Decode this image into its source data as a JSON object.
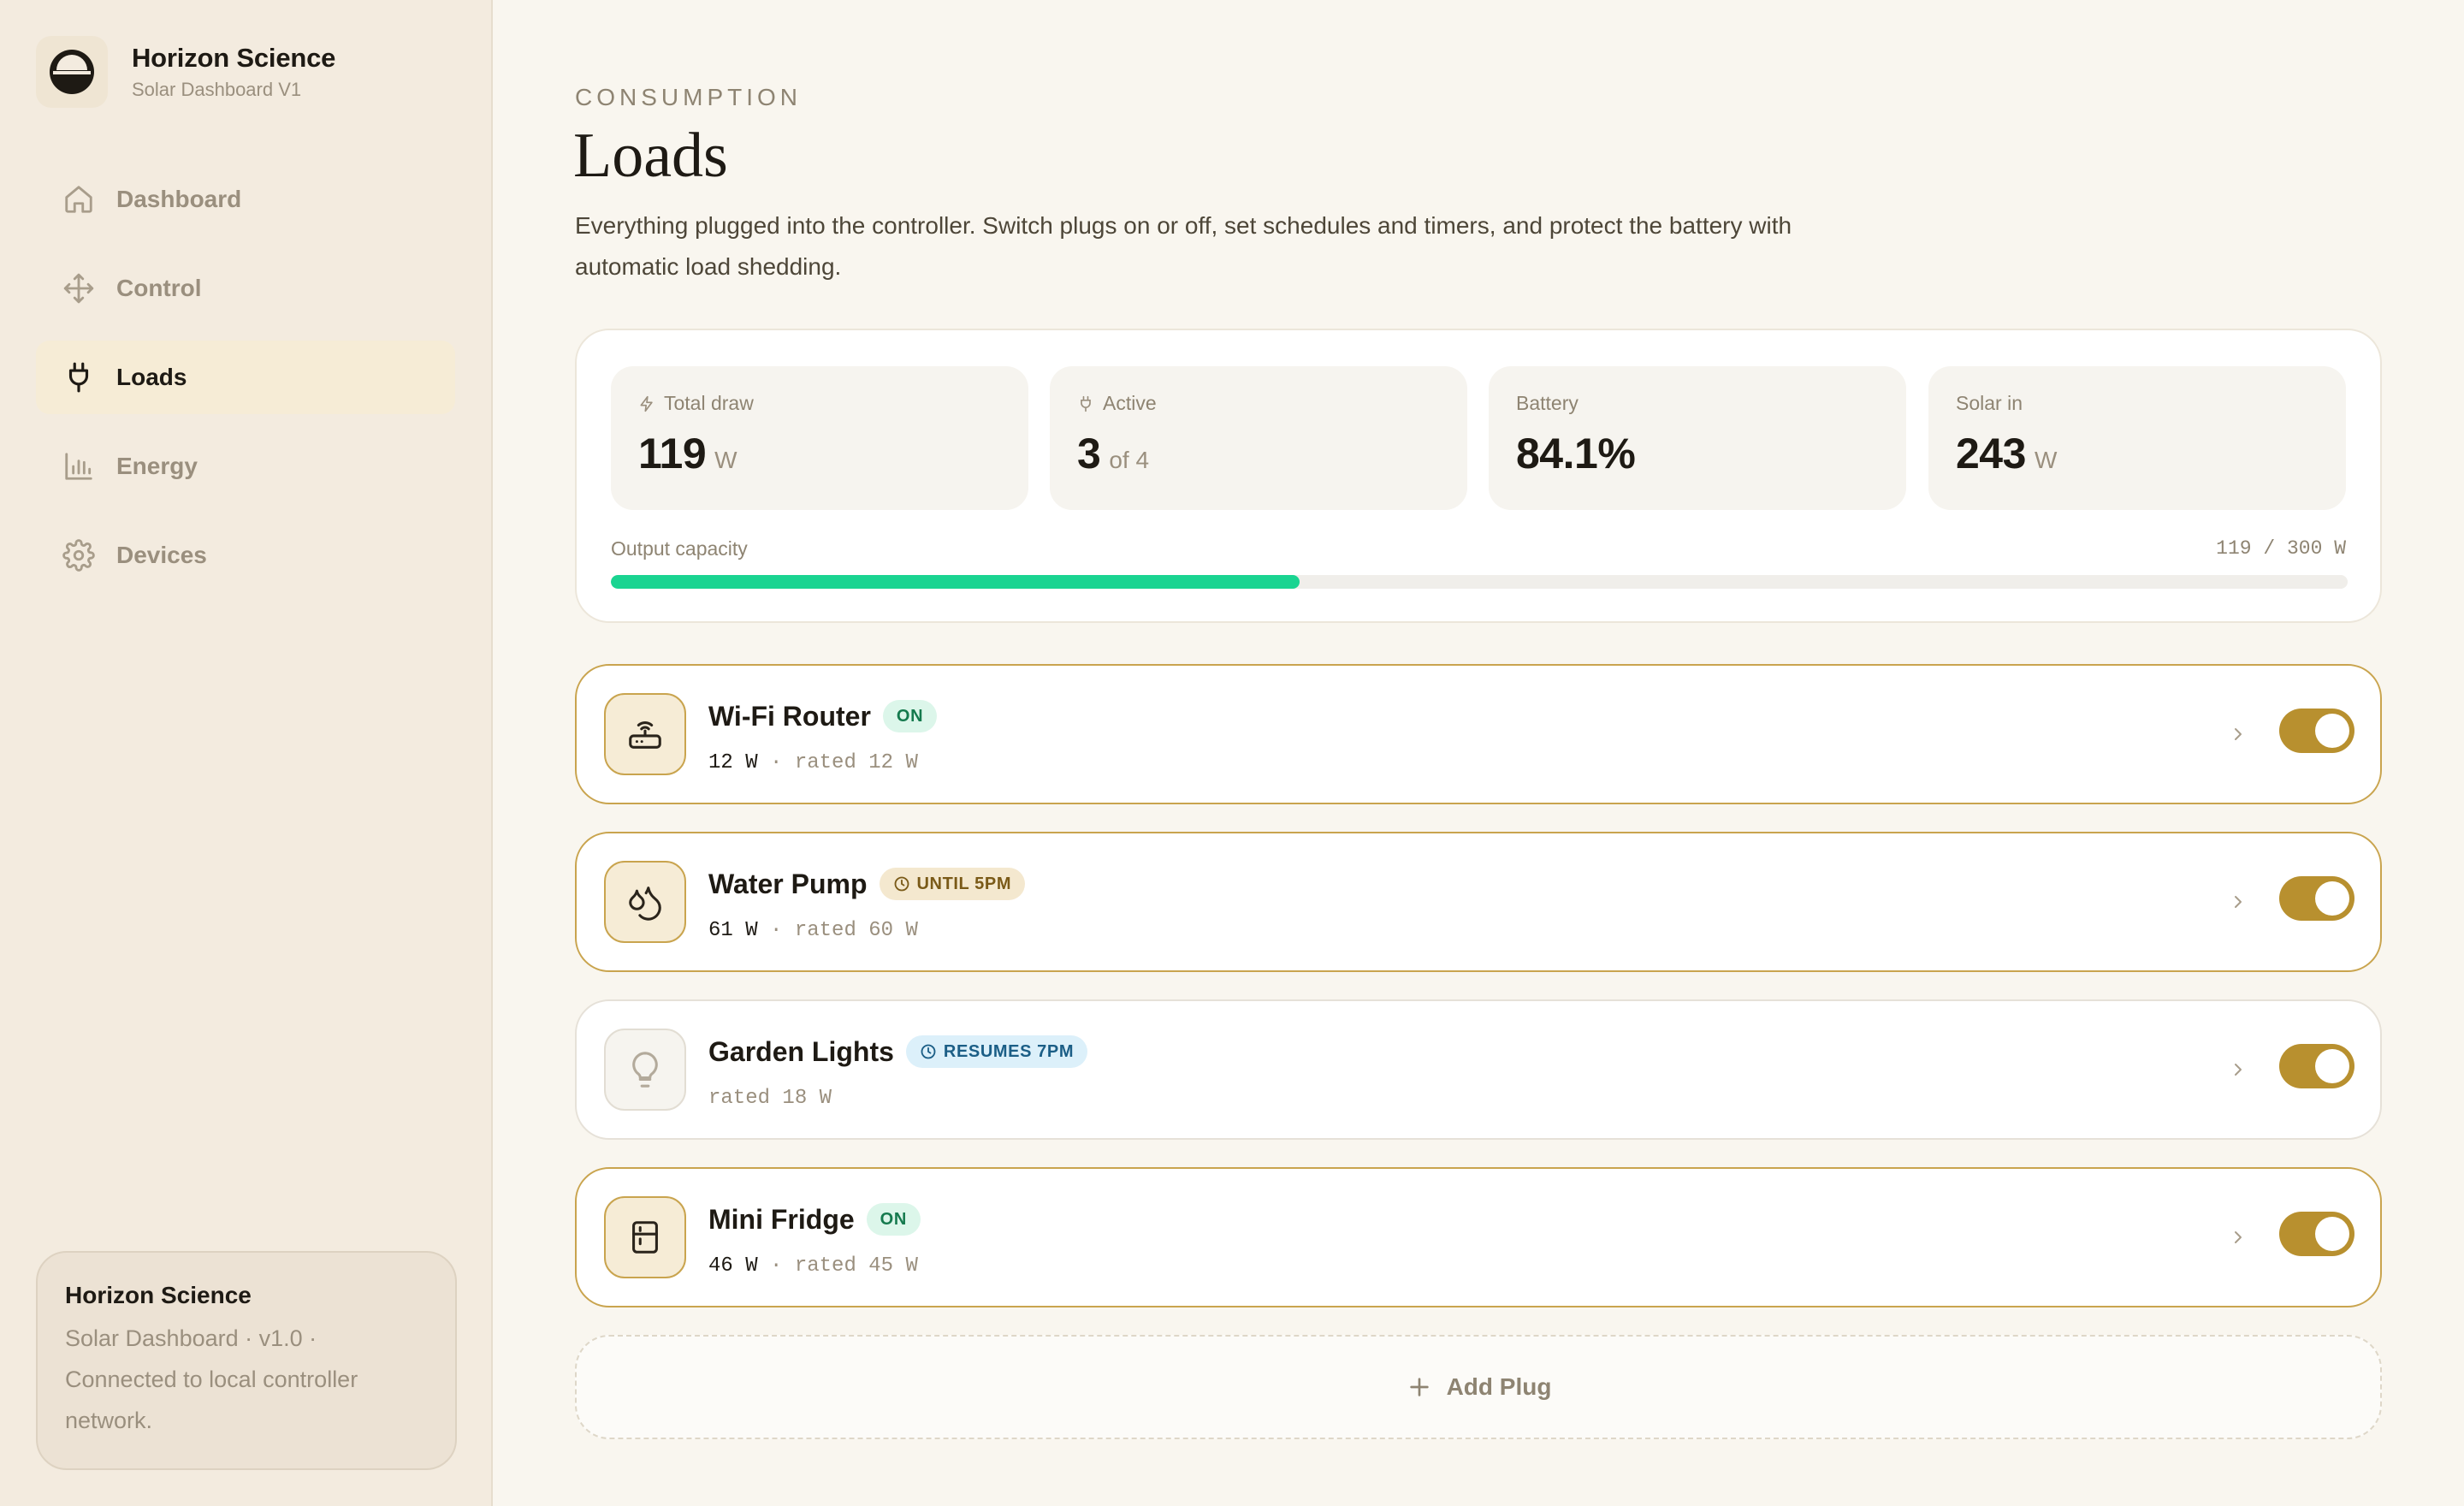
{
  "brand": {
    "title": "Horizon Science",
    "subtitle": "Solar Dashboard V1"
  },
  "sidebar": {
    "items": [
      {
        "label": "Dashboard",
        "icon": "home-icon"
      },
      {
        "label": "Control",
        "icon": "move-icon"
      },
      {
        "label": "Loads",
        "icon": "plug-icon",
        "active": true
      },
      {
        "label": "Energy",
        "icon": "bar-chart-icon"
      },
      {
        "label": "Devices",
        "icon": "gear-icon"
      }
    ],
    "footer": {
      "title": "Horizon Science",
      "body": "Solar Dashboard · v1.0 · Connected to local controller network."
    }
  },
  "header": {
    "eyebrow": "CONSUMPTION",
    "title": "Loads",
    "description": "Everything plugged into the controller. Switch plugs on or off, set schedules and timers, and protect the battery with automatic load shedding."
  },
  "stats": {
    "total_draw": {
      "label": "Total draw",
      "value": "119",
      "unit": "W"
    },
    "active": {
      "label": "Active",
      "value": "3",
      "unit": "of 4"
    },
    "battery": {
      "label": "Battery",
      "value": "84.1%"
    },
    "solar_in": {
      "label": "Solar in",
      "value": "243",
      "unit": "W"
    },
    "capacity": {
      "label": "Output capacity",
      "value_text": "119 / 300 W",
      "fraction": 0.3967
    }
  },
  "plugs": [
    {
      "name": "Wi-Fi Router",
      "badge": "ON",
      "watts": "12 W",
      "rated": "rated 12 W",
      "enabled": true,
      "icon": "router-icon"
    },
    {
      "name": "Water Pump",
      "badge": "UNTIL 5PM",
      "watts": "61 W",
      "rated": "rated 60 W",
      "enabled": true,
      "icon": "water-drops-icon"
    },
    {
      "name": "Garden Lights",
      "badge": "RESUMES 7PM",
      "watts": "",
      "rated": "rated 18 W",
      "enabled": true,
      "icon": "lightbulb-icon"
    },
    {
      "name": "Mini Fridge",
      "badge": "ON",
      "watts": "46 W",
      "rated": "rated 45 W",
      "enabled": true,
      "icon": "fridge-icon"
    }
  ],
  "add_plug": {
    "label": "Add Plug"
  },
  "colors": {
    "accent": "#b8902f",
    "accent_border": "#c9a44e",
    "progress": "#1ad491",
    "background": "#f9f6ef",
    "sidebar": "#f3ebdf"
  }
}
